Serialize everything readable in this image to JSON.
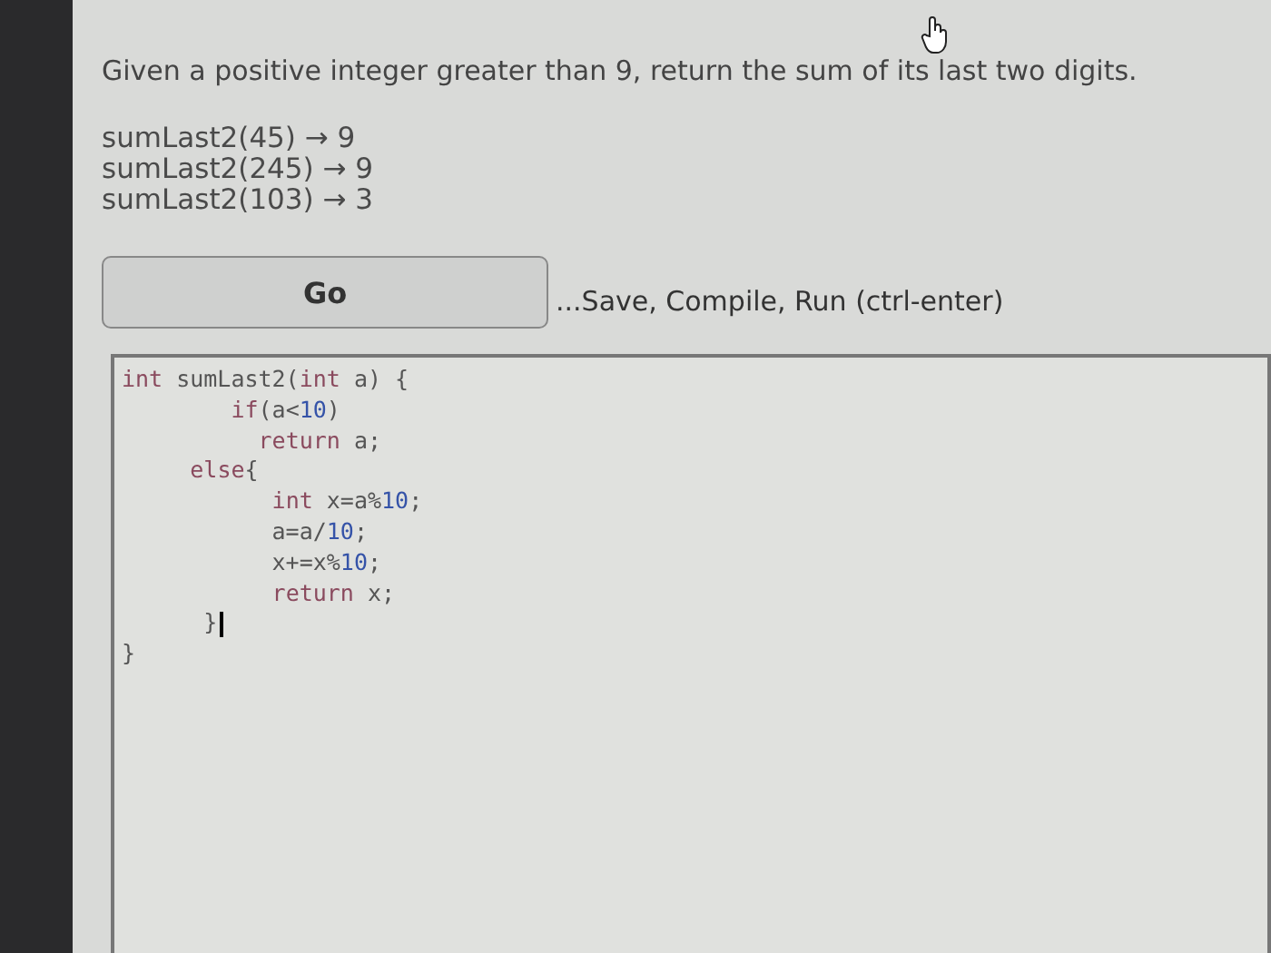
{
  "prompt": "Given a positive integer greater than 9, return the sum of its last two digits.",
  "examples": [
    "sumLast2(45) → 9",
    "sumLast2(245) → 9",
    "sumLast2(103) → 3"
  ],
  "go_button": "Go",
  "go_hint": "...Save, Compile, Run (ctrl-enter)",
  "code_lines": [
    "int sumLast2(int a) {",
    "        if(a<10)",
    "          return a;",
    "     else{",
    "           int x=a%10;",
    "           a=a/10;",
    "           x+=x%10;",
    "           return x;",
    "      }",
    "}"
  ]
}
